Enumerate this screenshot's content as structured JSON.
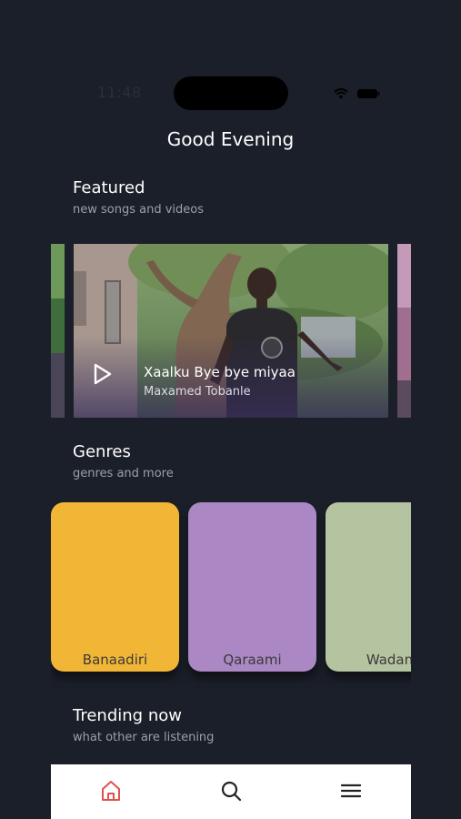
{
  "status_bar": {
    "time": "11:48"
  },
  "greeting": "Good Evening",
  "featured": {
    "title": "Featured",
    "subtitle": "new songs and videos",
    "item": {
      "song_title": "Xaalku Bye bye miyaa",
      "artist": "Maxamed Tobanle"
    }
  },
  "genres": {
    "title": "Genres",
    "subtitle": "genres and more",
    "items": [
      {
        "label": "Banaadiri",
        "color": "#f2b637"
      },
      {
        "label": "Qaraami",
        "color": "#ab88c4"
      },
      {
        "label": "Wadan",
        "color": "#b4c3a0"
      }
    ]
  },
  "trending": {
    "title": "Trending now",
    "subtitle": "what other are listening"
  },
  "nav": {
    "items": [
      {
        "icon": "home-icon",
        "active": true,
        "color": "#e0514f"
      },
      {
        "icon": "search-icon",
        "active": false,
        "color": "#222222"
      },
      {
        "icon": "menu-icon",
        "active": false,
        "color": "#222222"
      }
    ]
  }
}
